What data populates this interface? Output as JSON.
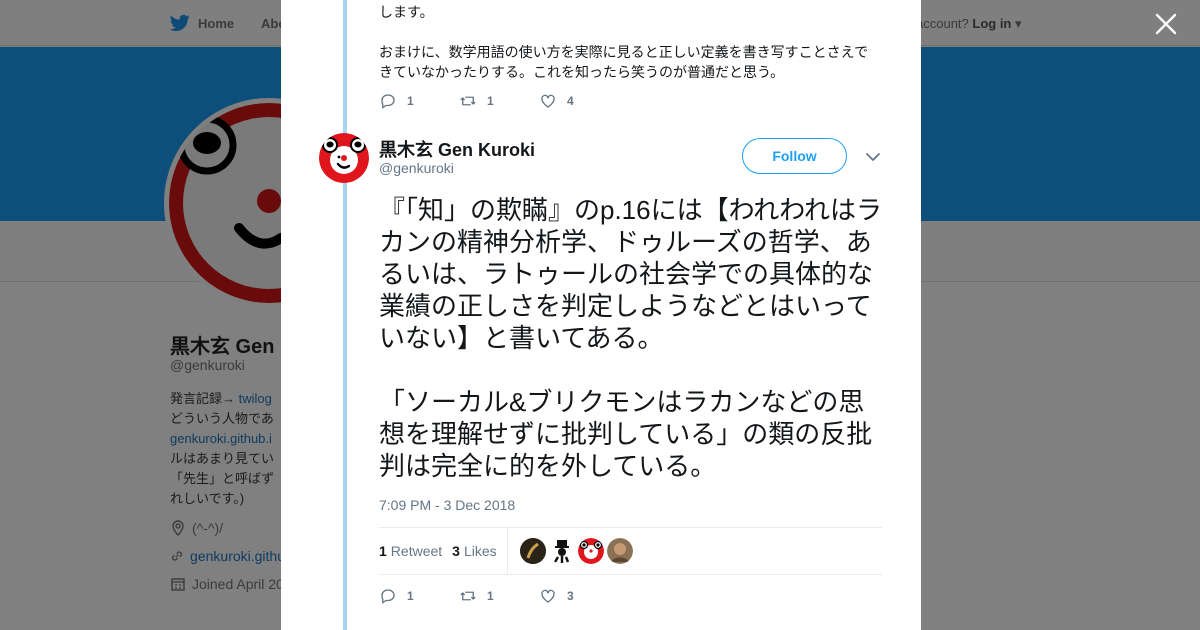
{
  "background": {
    "nav": {
      "home": "Home",
      "about": "Abo",
      "account_question": "account?",
      "login": "Log in"
    },
    "profile": {
      "name": "黒木玄 Gen",
      "handle": "@genkuroki",
      "bio_lines": [
        {
          "pre": "発言記録→ ",
          "link": "twilog"
        },
        {
          "pre": "どういう人物であ",
          "link": ""
        },
        {
          "pre": "",
          "link": "genkuroki.github.i"
        },
        {
          "pre": "ルはあまり見てい",
          "link": ""
        },
        {
          "pre": "「先生」と呼ばず",
          "link": ""
        },
        {
          "pre": "れしいです。)",
          "link": ""
        }
      ],
      "location": "(^-^)/",
      "website": "genkuroki.githu",
      "joined": "Joined April 20"
    }
  },
  "previous_tweet": {
    "text_paragraphs": [
      "します。",
      "おまけに、数学用語の使い方を実際に見ると正しい定義を書き写すことさえできていなかったりする。これを知ったら笑うのが普通だと思う。"
    ],
    "replies": "1",
    "retweets": "1",
    "likes": "4"
  },
  "tweet": {
    "author_name": "黒木玄 Gen Kuroki",
    "author_handle": "@genkuroki",
    "follow_label": "Follow",
    "text_paragraphs": [
      "『「知」の欺瞞』のp.16には【われわれはラカンの精神分析学、ドゥルーズの哲学、あるいは、ラトゥールの社会学での具体的な業績の正しさを判定しようなどとはいっていない】と書いてある。",
      "「ソーカル&ブリクモンはラカンなどの思想を理解せずに批判している」の類の反批判は完全に的を外している。"
    ],
    "timestamp": "7:09 PM - 3 Dec 2018",
    "retweet_count": "1",
    "retweet_label": "Retweet",
    "like_count": "3",
    "like_label": "Likes",
    "replies": "1",
    "retweets": "1",
    "likes": "3"
  },
  "colors": {
    "accent": "#1da1f2",
    "thread": "#a8d4f2",
    "banner": "#0e4e7b"
  }
}
